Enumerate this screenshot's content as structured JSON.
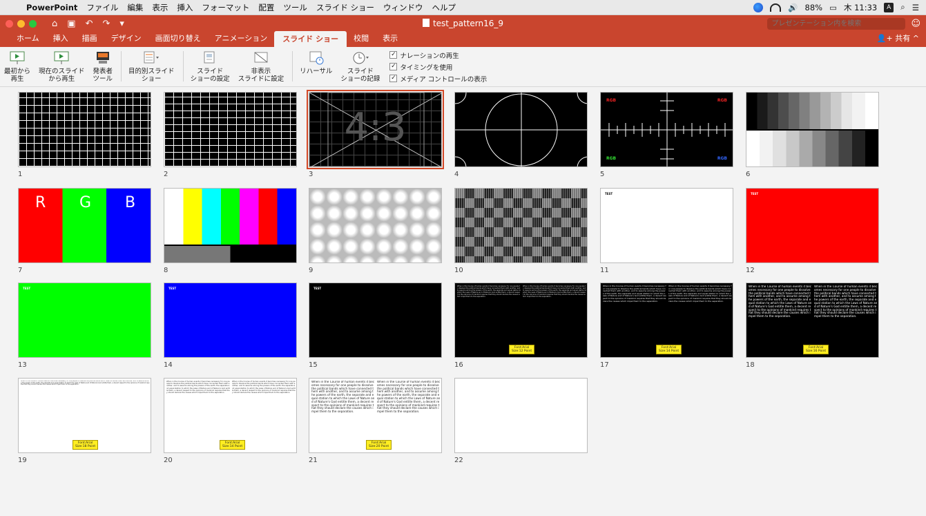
{
  "menubar": {
    "app_name": "PowerPoint",
    "items": [
      "ファイル",
      "編集",
      "表示",
      "挿入",
      "フォーマット",
      "配置",
      "ツール",
      "スライド ショー",
      "ウィンドウ",
      "ヘルプ"
    ],
    "battery": "88%",
    "clock": "木 11:33",
    "input_indicator": "A"
  },
  "window": {
    "title": "test_pattern16_9",
    "search_placeholder": "プレゼンテーション内を検索",
    "share_label": "共有"
  },
  "ribbon": {
    "tabs": [
      "ホーム",
      "挿入",
      "描画",
      "デザイン",
      "画面切り替え",
      "アニメーション",
      "スライド ショー",
      "校閲",
      "表示"
    ],
    "active_tab": "スライド ショー",
    "buttons": [
      {
        "label": "最初から\n再生"
      },
      {
        "label": "現在のスライド\nから再生"
      },
      {
        "label": "発表者\nツール"
      },
      {
        "label": "目的別スライド\nショー"
      },
      {
        "label": "スライド\nショーの設定"
      },
      {
        "label": "非表示\nスライドに設定"
      },
      {
        "label": "リハーサル"
      },
      {
        "label": "スライド\nショーの記録"
      }
    ],
    "checkboxes": [
      {
        "label": "ナレーションの再生",
        "checked": true
      },
      {
        "label": "タイミングを使用",
        "checked": true
      },
      {
        "label": "メディア コントロールの表示",
        "checked": true
      }
    ]
  },
  "slides": {
    "numbers": [
      "1",
      "2",
      "3",
      "4",
      "5",
      "6",
      "7",
      "8",
      "9",
      "10",
      "11",
      "12",
      "13",
      "14",
      "15",
      "16",
      "17",
      "18",
      "19",
      "20",
      "21",
      "22"
    ],
    "selected": 3,
    "aspect_text": "4:3",
    "rgb_labels": [
      "R",
      "G",
      "B"
    ],
    "rgb_corner": "RGB",
    "test_label": "TEST",
    "font_badges": [
      "Font:Arial\nSize:12 Point",
      "Font:Arial\nSize:14 Point",
      "Font:Arial\nSize:16 Point",
      "Font:Arial\nSize:18 Point",
      "Font:Arial\nSize:14 Point",
      "Font:Arial\nSize:20 Point"
    ],
    "sample_text": "When in the Course of human events it becomes necessary for one people to dissolve the political bands which have connected them with another, and to assume among the powers of the earth, the separate and equal station to which the Laws of Nature and of Nature's God entitle them, a decent respect to the opinions of mankind requires that they should declare the causes which impel them to the separation."
  },
  "colors": {
    "accent": "#c9452e",
    "selection": "#d24726"
  }
}
